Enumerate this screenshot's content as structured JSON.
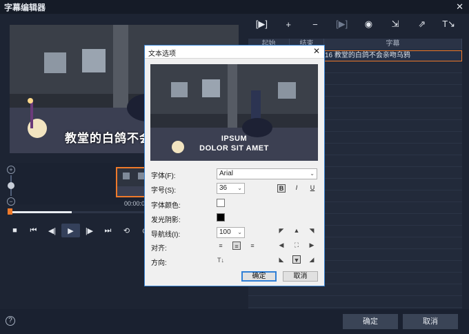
{
  "window": {
    "title": "字幕编辑器",
    "close_glyph": "✕"
  },
  "preview": {
    "caption": "教堂的白鸽不会来"
  },
  "timeline": {
    "clip_time": "00:00:00"
  },
  "playback": {
    "stop": "■",
    "prev": "⏮",
    "step_back": "◀|",
    "play": "▶",
    "step_fwd": "|▶",
    "next": "⏭",
    "loop": "⟲",
    "extra": "⊙"
  },
  "toolbar": {
    "icons": [
      "[▶]",
      "+",
      "−",
      "[▶]",
      "◉",
      "⇲",
      "⇗",
      "T↘"
    ]
  },
  "table": {
    "headers": [
      "起始",
      "结束",
      "字幕"
    ],
    "rows": [
      {
        "text": "16 教堂的白鸽不会亲吻乌鸦"
      }
    ]
  },
  "dialog": {
    "title": "文本选项",
    "close_glyph": "✕",
    "preview_lines": [
      "IPSUM",
      "DOLOR SIT AMET"
    ],
    "labels": {
      "font": "字体(F):",
      "size": "字号(S):",
      "color": "字体颜色:",
      "glow": "发光阴影:",
      "guide": "导航线(I):",
      "align": "对齐:",
      "direction": "方向:"
    },
    "font_value": "Arial",
    "size_value": "36",
    "guide_value": "100",
    "format": {
      "bold": "B",
      "italic": "I",
      "underline": "U"
    },
    "direction_glyph": "T↓",
    "ok": "确定",
    "cancel": "取消"
  },
  "footer": {
    "help": "?",
    "ok": "确定",
    "cancel": "取消"
  }
}
